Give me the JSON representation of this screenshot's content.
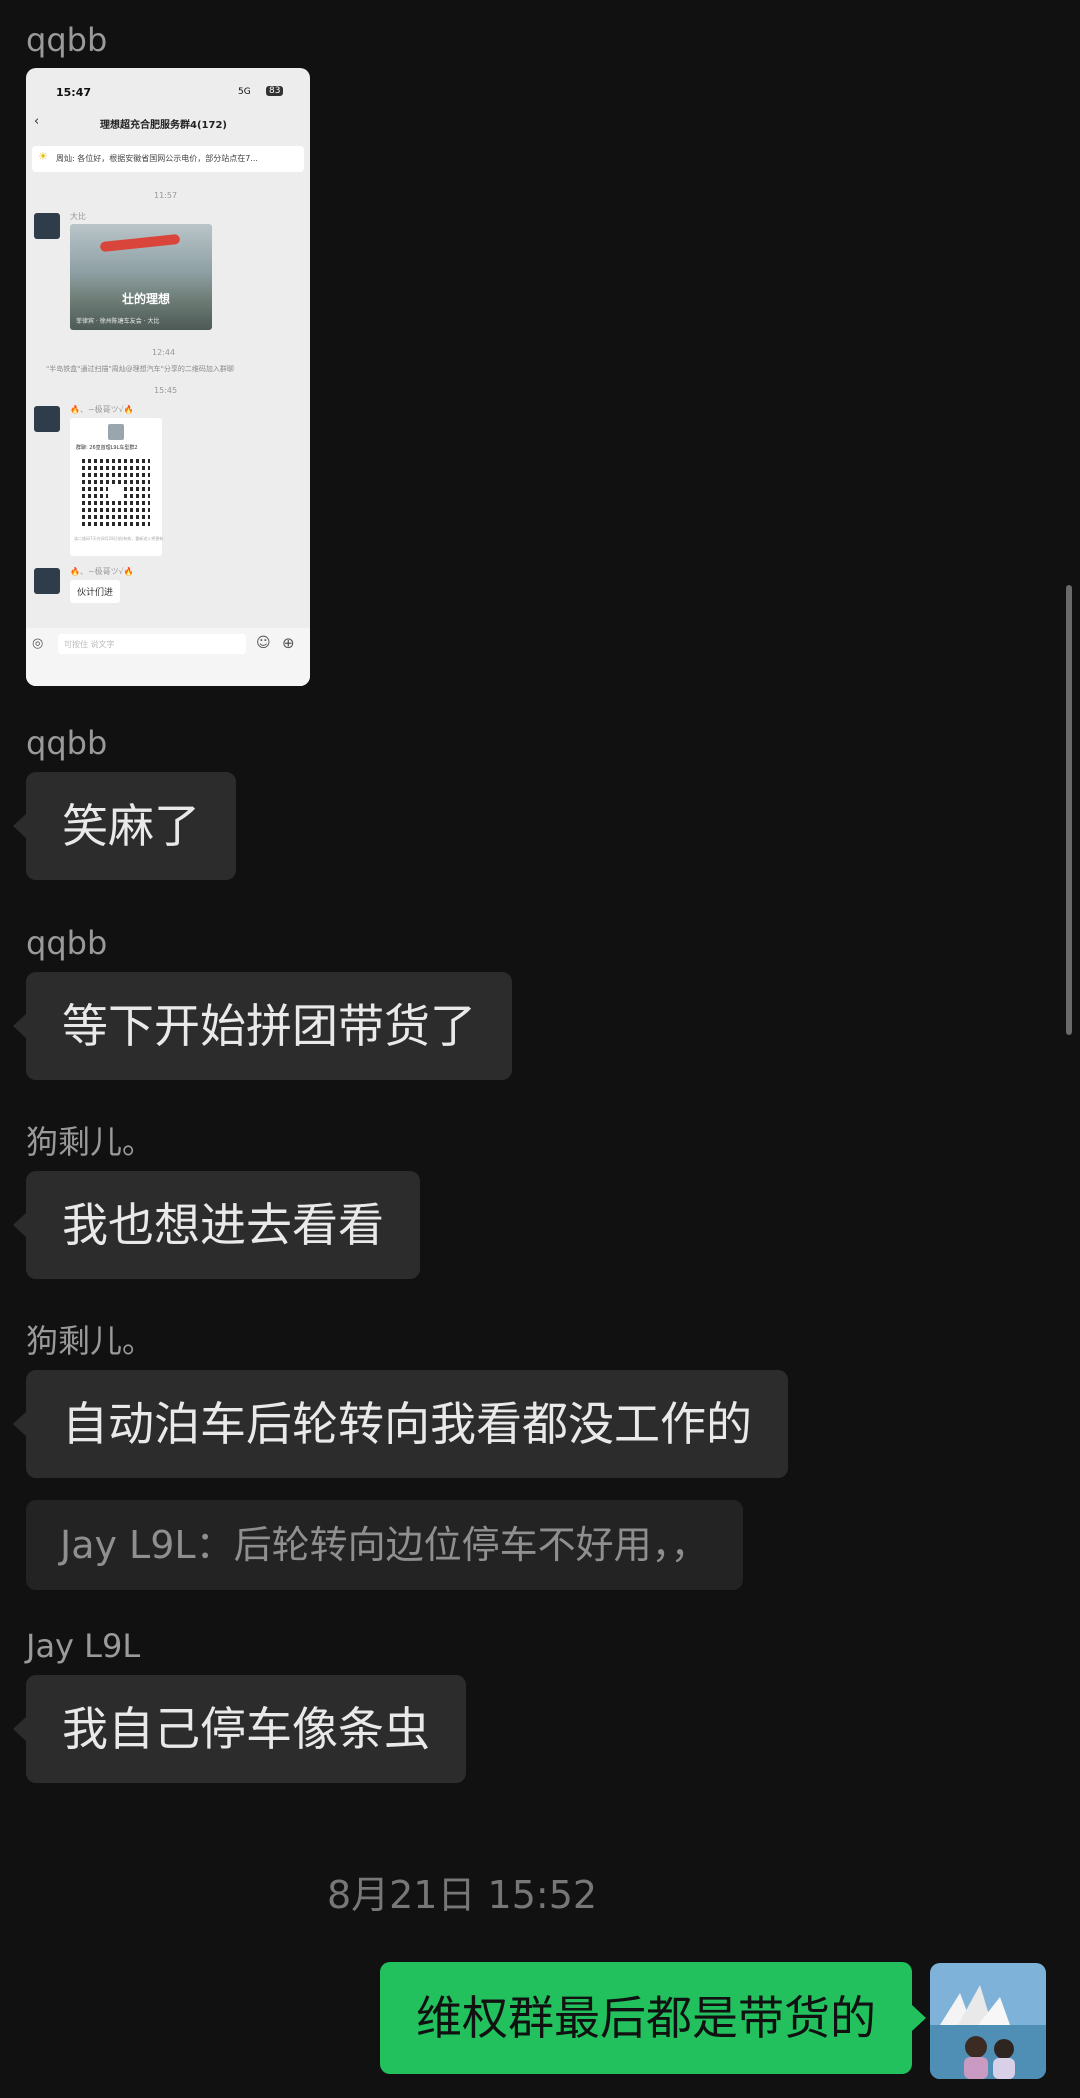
{
  "messages": [
    {
      "sender": "qqbb"
    },
    {
      "sender": "qqbb",
      "text": "笑麻了"
    },
    {
      "sender": "qqbb",
      "text": "等下开始拼团带货了"
    },
    {
      "sender": "狗剩儿。",
      "text": "我也想进去看看"
    },
    {
      "sender": "狗剩儿。",
      "text": "自动泊车后轮转向我看都没工作的",
      "quote": "Jay L9L：后轮转向边位停车不好用，，"
    },
    {
      "sender": "Jay L9L",
      "text": "我自己停车像条虫"
    }
  ],
  "timestamp": "8月21日 15:52",
  "my_message": "维权群最后都是带货的",
  "screenshot": {
    "status_time": "15:47",
    "status_net": "5G",
    "status_battery": "83",
    "title": "理想超充合肥服务群4(172)",
    "notice": "周灿: 各位好，根据安徽省国网公示电价，部分站点在7...",
    "time1": "11:57",
    "sender1": "大比",
    "video_caption": "菲律宾 · 徐州陈塘车友会 · 大比",
    "video_title": "壮的理想",
    "time2": "12:44",
    "system_msg": "\"半岛铁盒\"通过扫描\"周灿@理想汽车\"分享的二维码加入群聊",
    "time3": "15:45",
    "sender2": "🔥、~极哥ツ√🔥",
    "qr_label": "群聊: 26皇首理L9L车型群2",
    "qr_hint": "该二维码7天内(8月28日前)有效，重新进入将更新",
    "sender3": "🔥、~极哥ツ√🔥",
    "msg3": "伙计们进",
    "input_placeholder": "可按住 说文字"
  },
  "colors": {
    "bg": "#111111",
    "bubble": "#2c2c2c",
    "mine": "#22c15e"
  }
}
